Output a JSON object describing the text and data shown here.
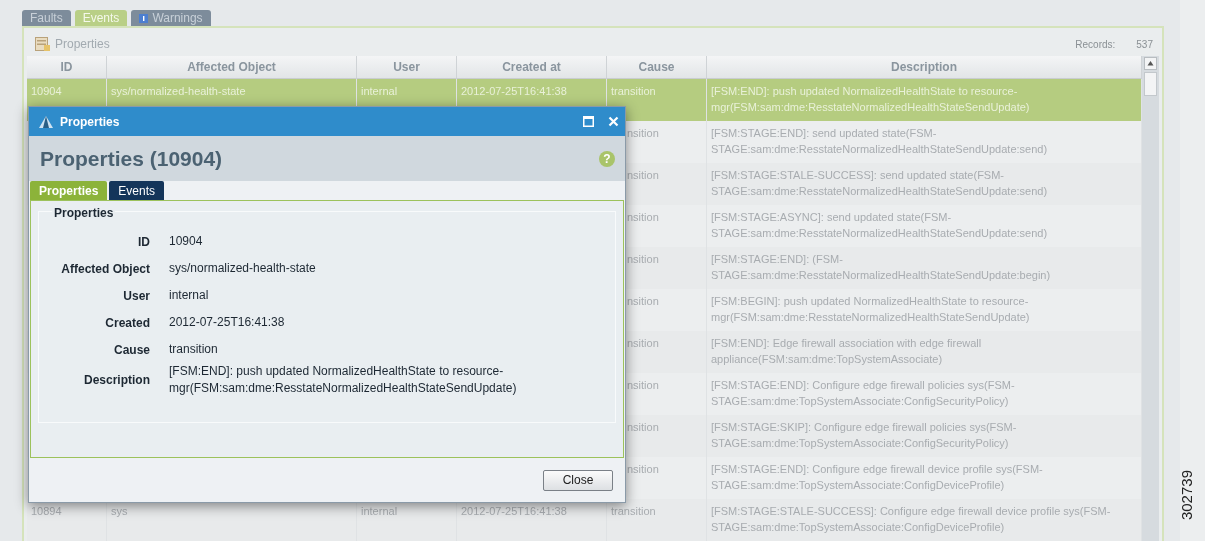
{
  "tabs": [
    {
      "label": "Faults",
      "selected": false,
      "kind": "plain"
    },
    {
      "label": "Events",
      "selected": true,
      "kind": "plain"
    },
    {
      "label": "Warnings",
      "selected": false,
      "kind": "warning"
    }
  ],
  "panel": {
    "title": "Properties",
    "records_label": "Records:",
    "records_count": "537"
  },
  "table": {
    "columns": [
      "ID",
      "Affected Object",
      "User",
      "Created at",
      "Cause",
      "Description"
    ],
    "rows": [
      {
        "selected": true,
        "cells": [
          "10904",
          "sys/normalized-health-state",
          "internal",
          "2012-07-25T16:41:38",
          "transition",
          "[FSM:END]: push updated NormalizedHealthState to resource-mgr(FSM:sam:dme:ResstateNormalizedHealthStateSendUpdate)"
        ]
      },
      {
        "selected": false,
        "cells": [
          "nsition",
          "[FSM:STAGE:END]: send updated state(FSM-STAGE:sam:dme:ResstateNormalizedHealthStateSendUpdate:send)"
        ]
      },
      {
        "selected": false,
        "cells": [
          "nsition",
          "[FSM:STAGE:STALE-SUCCESS]: send updated state(FSM-STAGE:sam:dme:ResstateNormalizedHealthStateSendUpdate:send)"
        ]
      },
      {
        "selected": false,
        "cells": [
          "nsition",
          "[FSM:STAGE:ASYNC]: send updated state(FSM-STAGE:sam:dme:ResstateNormalizedHealthStateSendUpdate:send)"
        ]
      },
      {
        "selected": false,
        "cells": [
          "nsition",
          "[FSM:STAGE:END]: (FSM-STAGE:sam:dme:ResstateNormalizedHealthStateSendUpdate:begin)"
        ]
      },
      {
        "selected": false,
        "cells": [
          "nsition",
          "[FSM:BEGIN]: push updated NormalizedHealthState to resource-mgr(FSM:sam:dme:ResstateNormalizedHealthStateSendUpdate)"
        ]
      },
      {
        "selected": false,
        "cells": [
          "nsition",
          "[FSM:END]: Edge firewall association with edge firewall appliance(FSM:sam:dme:TopSystemAssociate)"
        ]
      },
      {
        "selected": false,
        "cells": [
          "nsition",
          "[FSM:STAGE:END]: Configure edge firewall policies sys(FSM-STAGE:sam:dme:TopSystemAssociate:ConfigSecurityPolicy)"
        ]
      },
      {
        "selected": false,
        "cells": [
          "nsition",
          "[FSM:STAGE:SKIP]: Configure edge firewall policies sys(FSM-STAGE:sam:dme:TopSystemAssociate:ConfigSecurityPolicy)"
        ]
      },
      {
        "selected": false,
        "cells": [
          "nsition",
          "[FSM:STAGE:END]: Configure edge firewall device profile sys(FSM-STAGE:sam:dme:TopSystemAssociate:ConfigDeviceProfile)"
        ]
      },
      {
        "selected": false,
        "cells": [
          "10894",
          "sys",
          "internal",
          "2012-07-25T16:41:38",
          "transition",
          "[FSM:STAGE:STALE-SUCCESS]: Configure edge firewall device profile sys(FSM-STAGE:sam:dme:TopSystemAssociate:ConfigDeviceProfile)"
        ]
      }
    ]
  },
  "dialog": {
    "title": "Properties",
    "heading": "Properties (10904)",
    "help_glyph": "?",
    "tabs": [
      {
        "label": "Properties",
        "selected": true
      },
      {
        "label": "Events",
        "selected": false
      }
    ],
    "group_title": "Properties",
    "fields": [
      {
        "label": "ID",
        "value": "10904"
      },
      {
        "label": "Affected Object",
        "value": "sys/normalized-health-state"
      },
      {
        "label": "User",
        "value": "internal"
      },
      {
        "label": "Created",
        "value": "2012-07-25T16:41:38"
      },
      {
        "label": "Cause",
        "value": "transition"
      },
      {
        "label": "Description",
        "value": "[FSM:END]: push updated NormalizedHealthState to resource-mgr(FSM:sam:dme:ResstateNormalizedHealthStateSendUpdate)"
      }
    ],
    "close_button": "Close"
  },
  "figure_number": "302739"
}
